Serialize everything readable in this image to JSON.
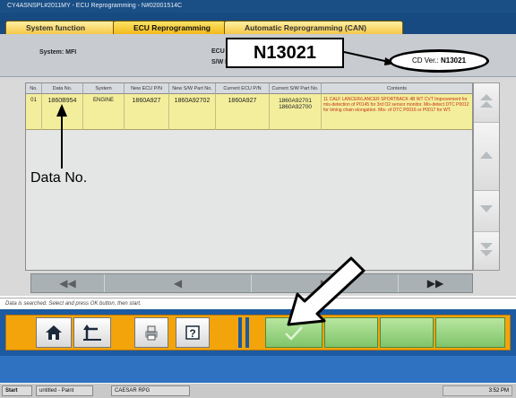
{
  "window": {
    "title": "CY4ASNSPL#2011MY  -  ECU Reprogramming  -  N#02001514C"
  },
  "tabs": [
    {
      "label": "System function",
      "active": false
    },
    {
      "label": "ECU Reprogramming",
      "active": true
    },
    {
      "label": "Automatic Reprogramming (CAN)",
      "active": false
    }
  ],
  "info": {
    "system_label": "System: MFI",
    "ecu_part_label": "ECU Part No.",
    "sw_part_label": "S/W Part No."
  },
  "callout": {
    "code": "N13021",
    "cd_ver_label": "CD Ver.:",
    "cd_ver_value": "N13021"
  },
  "table": {
    "headers": [
      "No.",
      "Data No.",
      "System",
      "New ECU P/N",
      "New S/W Part No.",
      "Current ECU P/N",
      "Current S/W Part No.",
      "Contents"
    ],
    "rows": [
      {
        "no": "01",
        "data_no": "1860B954",
        "system": "ENGINE",
        "new_ecu": "1860A927",
        "new_sw": "1860A92702",
        "cur_ecu": "1860A927",
        "cur_sw_1": "1860A92701",
        "cur_sw_2": "1860A92700",
        "contents": "11 CALF LANCER/LANCER SPORTBACK 4B WT CVT  Improvement for mis-detection of P0145 for 3rd O2 sensor monitor. Mis-detect DTC P0012 for timing chain elongation. Mis- of DTC P0016 or P0017 for WT."
      }
    ]
  },
  "annotation": {
    "data_no_label": "Data No."
  },
  "hscroll": {
    "first": "◀◀",
    "prev": "◀",
    "next": "▶",
    "last": "▶▶"
  },
  "status": {
    "message": "Data is searched. Select and press OK button, then start."
  },
  "toolbar": {
    "icons": [
      "home-icon",
      "back-icon",
      "print-icon",
      "help-icon",
      "ok-check-icon"
    ]
  },
  "taskbar": {
    "start_label": "Start",
    "task1": "untitled - Paint",
    "task2": "CAESAR RPG",
    "clock": "3:52 PM"
  },
  "colors": {
    "accent_blue": "#1c5aa2",
    "tab_yellow": "#f2b919",
    "row_highlight": "#f3ee9c",
    "toolbar_orange": "#f2a40a",
    "ok_green": "#7fc46a"
  }
}
